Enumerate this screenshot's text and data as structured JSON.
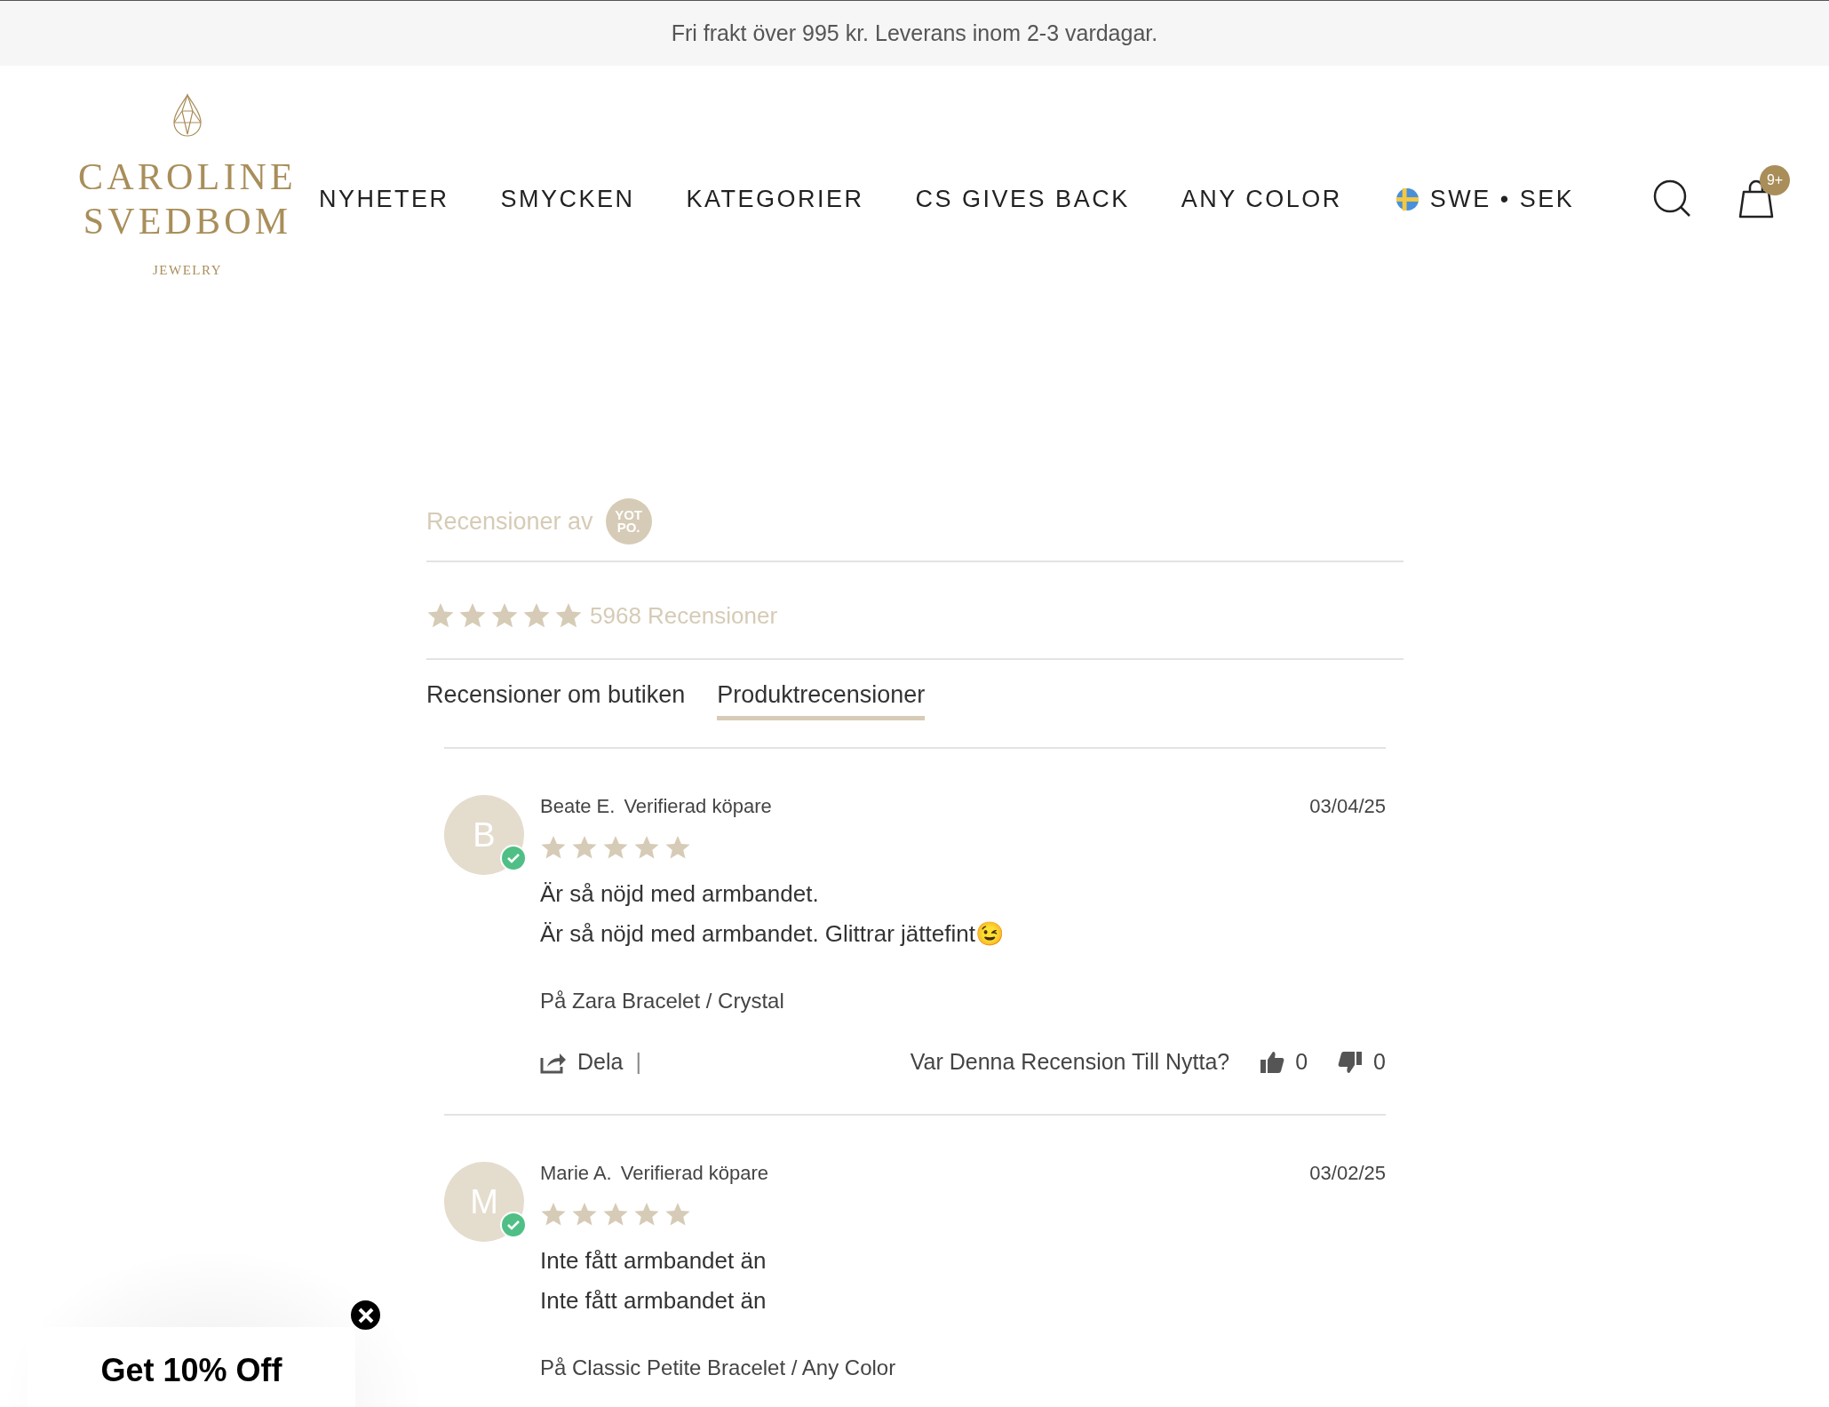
{
  "announcement": "Fri frakt över 995 kr. Leverans inom 2-3 vardagar.",
  "logo": {
    "line1": "CAROLINE",
    "line2": "SVEDBOM",
    "line3": "JEWELRY"
  },
  "nav": [
    "NYHETER",
    "SMYCKEN",
    "KATEGORIER",
    "CS GIVES BACK",
    "ANY COLOR"
  ],
  "locale": "SWE • SEK",
  "cart_badge": "9+",
  "reviews_by": "Recensioner av",
  "yotpo_logo": {
    "line1": "YOT",
    "line2": "PO."
  },
  "summary": {
    "stars": 5,
    "count": "5968 Recensioner"
  },
  "tabs": [
    {
      "label": "Recensioner om butiken",
      "selected": false
    },
    {
      "label": "Produktrecensioner",
      "selected": true
    }
  ],
  "reviews": [
    {
      "initial": "B",
      "name": "Beate E.",
      "badge": "Verifierad köpare",
      "date": "03/04/25",
      "stars": 5,
      "title": "Är så nöjd med armbandet.",
      "body": "Är så nöjd med armbandet. Glittrar jättefint😉",
      "product": "På Zara Bracelet / Crystal",
      "share": "Dela",
      "separator": "|",
      "helpful_question": "Var Denna Recension Till Nytta?",
      "up": "0",
      "down": "0"
    },
    {
      "initial": "M",
      "name": "Marie A.",
      "badge": "Verifierad köpare",
      "date": "03/02/25",
      "stars": 5,
      "title": "Inte fått armbandet än",
      "body": "Inte fått armbandet än",
      "product": "På Classic Petite Bracelet / Any Color"
    }
  ],
  "popup": {
    "title": "Get 10% Off"
  }
}
